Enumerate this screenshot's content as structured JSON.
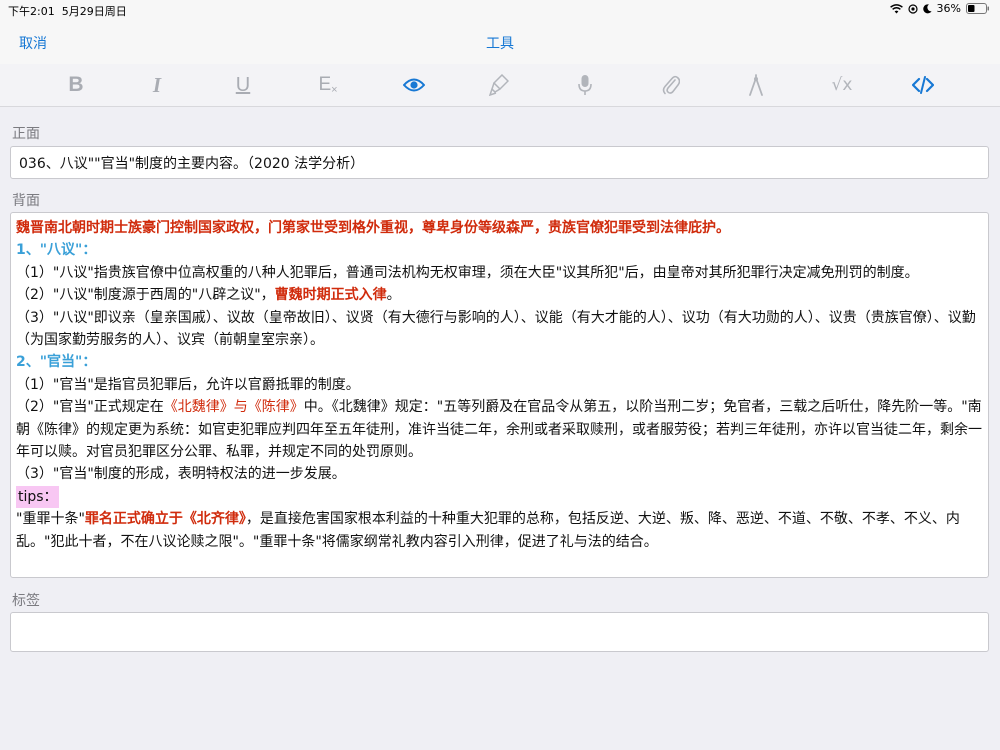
{
  "status": {
    "time": "下午2:01",
    "date": "5月29日周日",
    "battery": "36%"
  },
  "nav": {
    "cancel": "取消",
    "title": "工具"
  },
  "toolbar": {
    "icons": [
      "bold-icon",
      "italic-icon",
      "underline-icon",
      "clear-format-icon",
      "preview-icon",
      "highlighter-icon",
      "microphone-icon",
      "attachment-icon",
      "draw-icon",
      "math-icon",
      "html-code-icon"
    ],
    "bold": "B",
    "italic": "I",
    "underline": "U",
    "clear_format": "E",
    "math": "√x"
  },
  "labels": {
    "front": "正面",
    "back": "背面",
    "tags": "标签"
  },
  "front": {
    "value": "036、八议\"\"官当\"制度的主要内容。（2020 法学分析）"
  },
  "back": {
    "l1": "魏晋南北朝时期士族豪门控制国家政权，门第家世受到格外重视，尊卑身份等级森严，贵族官僚犯罪受到法律庇护。",
    "h1": "1、\"八议\"：",
    "p1": "（1）\"八议\"指贵族官僚中位高权重的八种人犯罪后，普通司法机构无权审理，须在大臣\"议其所犯\"后，由皇帝对其所犯罪行决定减免刑罚的制度。",
    "p2a": "（2）\"八议\"制度源于西周的\"八辟之议\"，",
    "p2b": "曹魏时期正式入律",
    "p2c": "。",
    "p3": "（3）\"八议\"即议亲（皇亲国戚）、议故（皇帝故旧）、议贤（有大德行与影响的人）、议能（有大才能的人）、议功（有大功勋的人）、议贵（贵族官僚）、议勤（为国家勤劳服务的人）、议宾（前朝皇室宗亲）。",
    "h2": "2、\"官当\"：",
    "q1": "（1）\"官当\"是指官员犯罪后，允许以官爵抵罪的制度。",
    "q2a": "（2）\"官当\"正式规定在",
    "q2b": "《北魏律》与《陈律》",
    "q2c": "中。《北魏律》规定：\"五等列爵及在官品令从第五，以阶当刑二岁；免官者，三载之后听仕，降先阶一等。\"南朝《陈律》的规定更为系统：如官吏犯罪应判四年至五年徒刑，准许当徒二年，余刑或者采取赎刑，或者服劳役；若判三年徒刑，亦许以官当徒二年，剩余一年可以赎。对官员犯罪区分公罪、私罪，并规定不同的处罚原则。",
    "q3": "（3）\"官当\"制度的形成，表明特权法的进一步发展。",
    "tips": "tips：",
    "t1a": "\"重罪十条\"",
    "t1b": "罪名正式确立于《北齐律》",
    "t1c": "，是直接危害国家根本利益的十种重大犯罪的总称，包括反逆、大逆、叛、降、恶逆、不道、不敬、不孝、不义、内乱。\"犯此十者，不在八议论赎之限\"。\"重罪十条\"将儒家纲常礼教内容引入刑律，促进了礼与法的结合。"
  },
  "tags": {
    "value": ""
  }
}
